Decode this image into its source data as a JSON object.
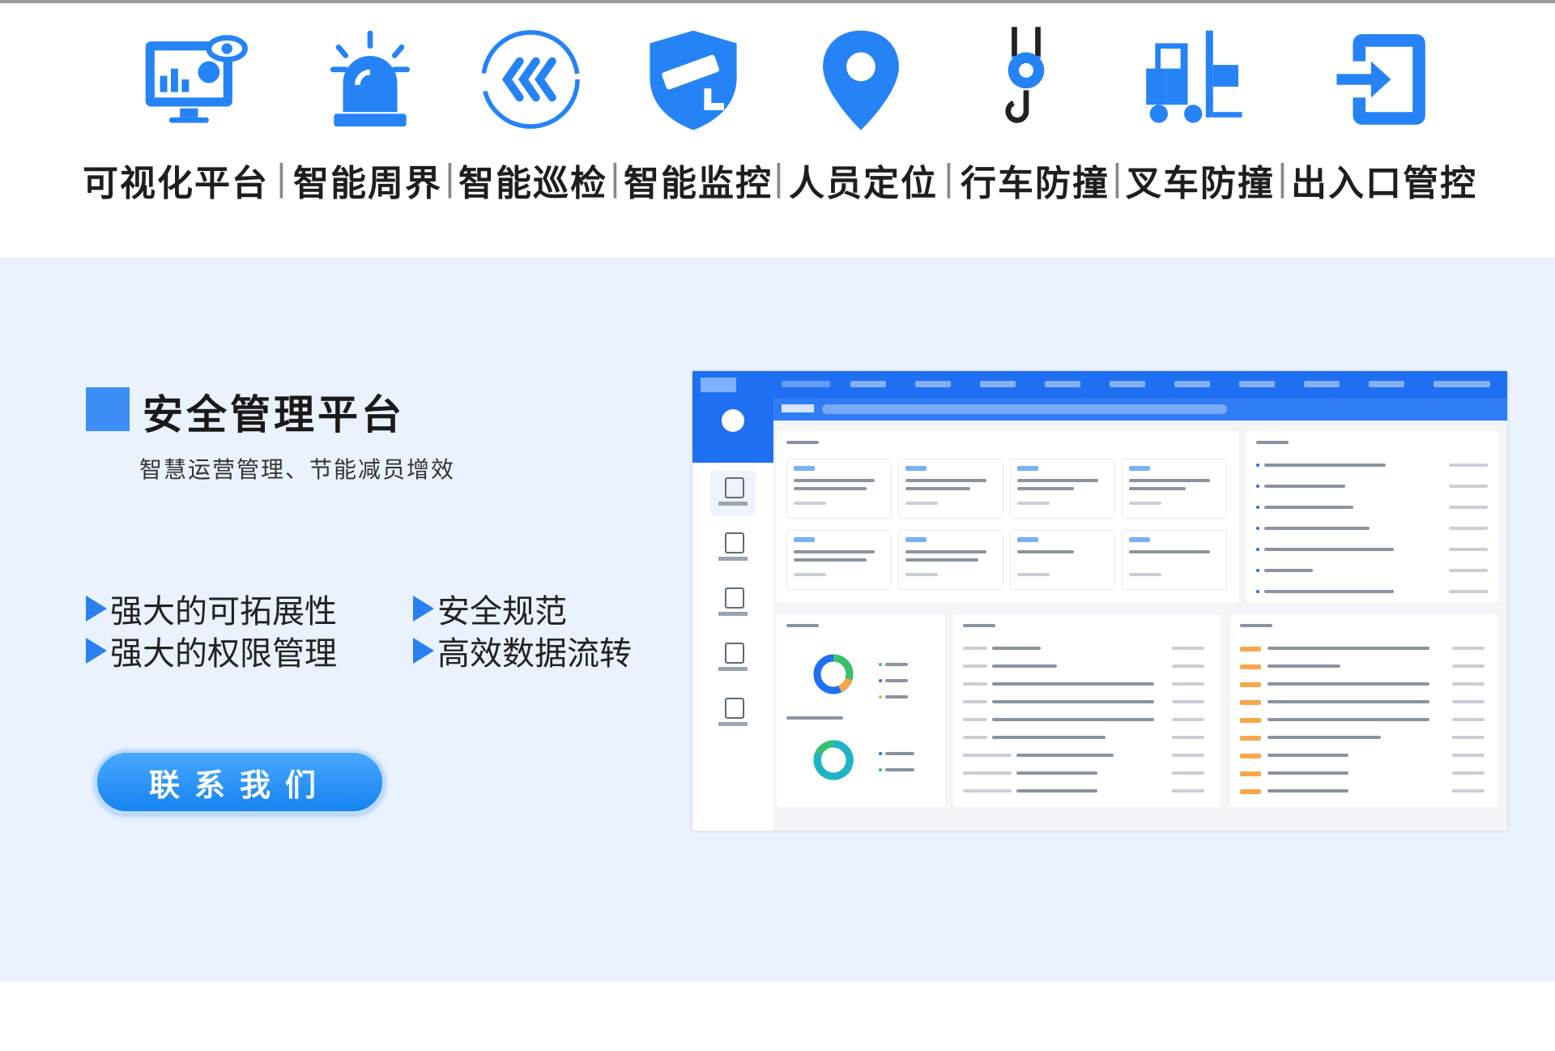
{
  "icons": [
    {
      "name": "dashboard-monitor-icon",
      "label": "可视化平台"
    },
    {
      "name": "alarm-siren-icon",
      "label": "智能周界"
    },
    {
      "name": "patrol-chevrons-icon",
      "label": "智能巡检"
    },
    {
      "name": "security-camera-shield-icon",
      "label": "智能监控"
    },
    {
      "name": "location-pin-icon",
      "label": "人员定位"
    },
    {
      "name": "crane-hook-icon",
      "label": "行车防撞"
    },
    {
      "name": "forklift-icon",
      "label": "叉车防撞"
    },
    {
      "name": "entrance-exit-icon",
      "label": "出入口管控"
    }
  ],
  "separator": "|",
  "section": {
    "title": "安全管理平台",
    "subtitle": "智慧运营管理、节能减员增效"
  },
  "features": [
    "强大的可拓展性",
    "强大的权限管理",
    "安全规范",
    "高效数据流转"
  ],
  "cta": {
    "label": "联系我们"
  },
  "colors": {
    "accent": "#3d8ef7",
    "panel_bg": "#e9f2fd",
    "app_header": "#1f6ff2",
    "button": "#1583f0"
  }
}
